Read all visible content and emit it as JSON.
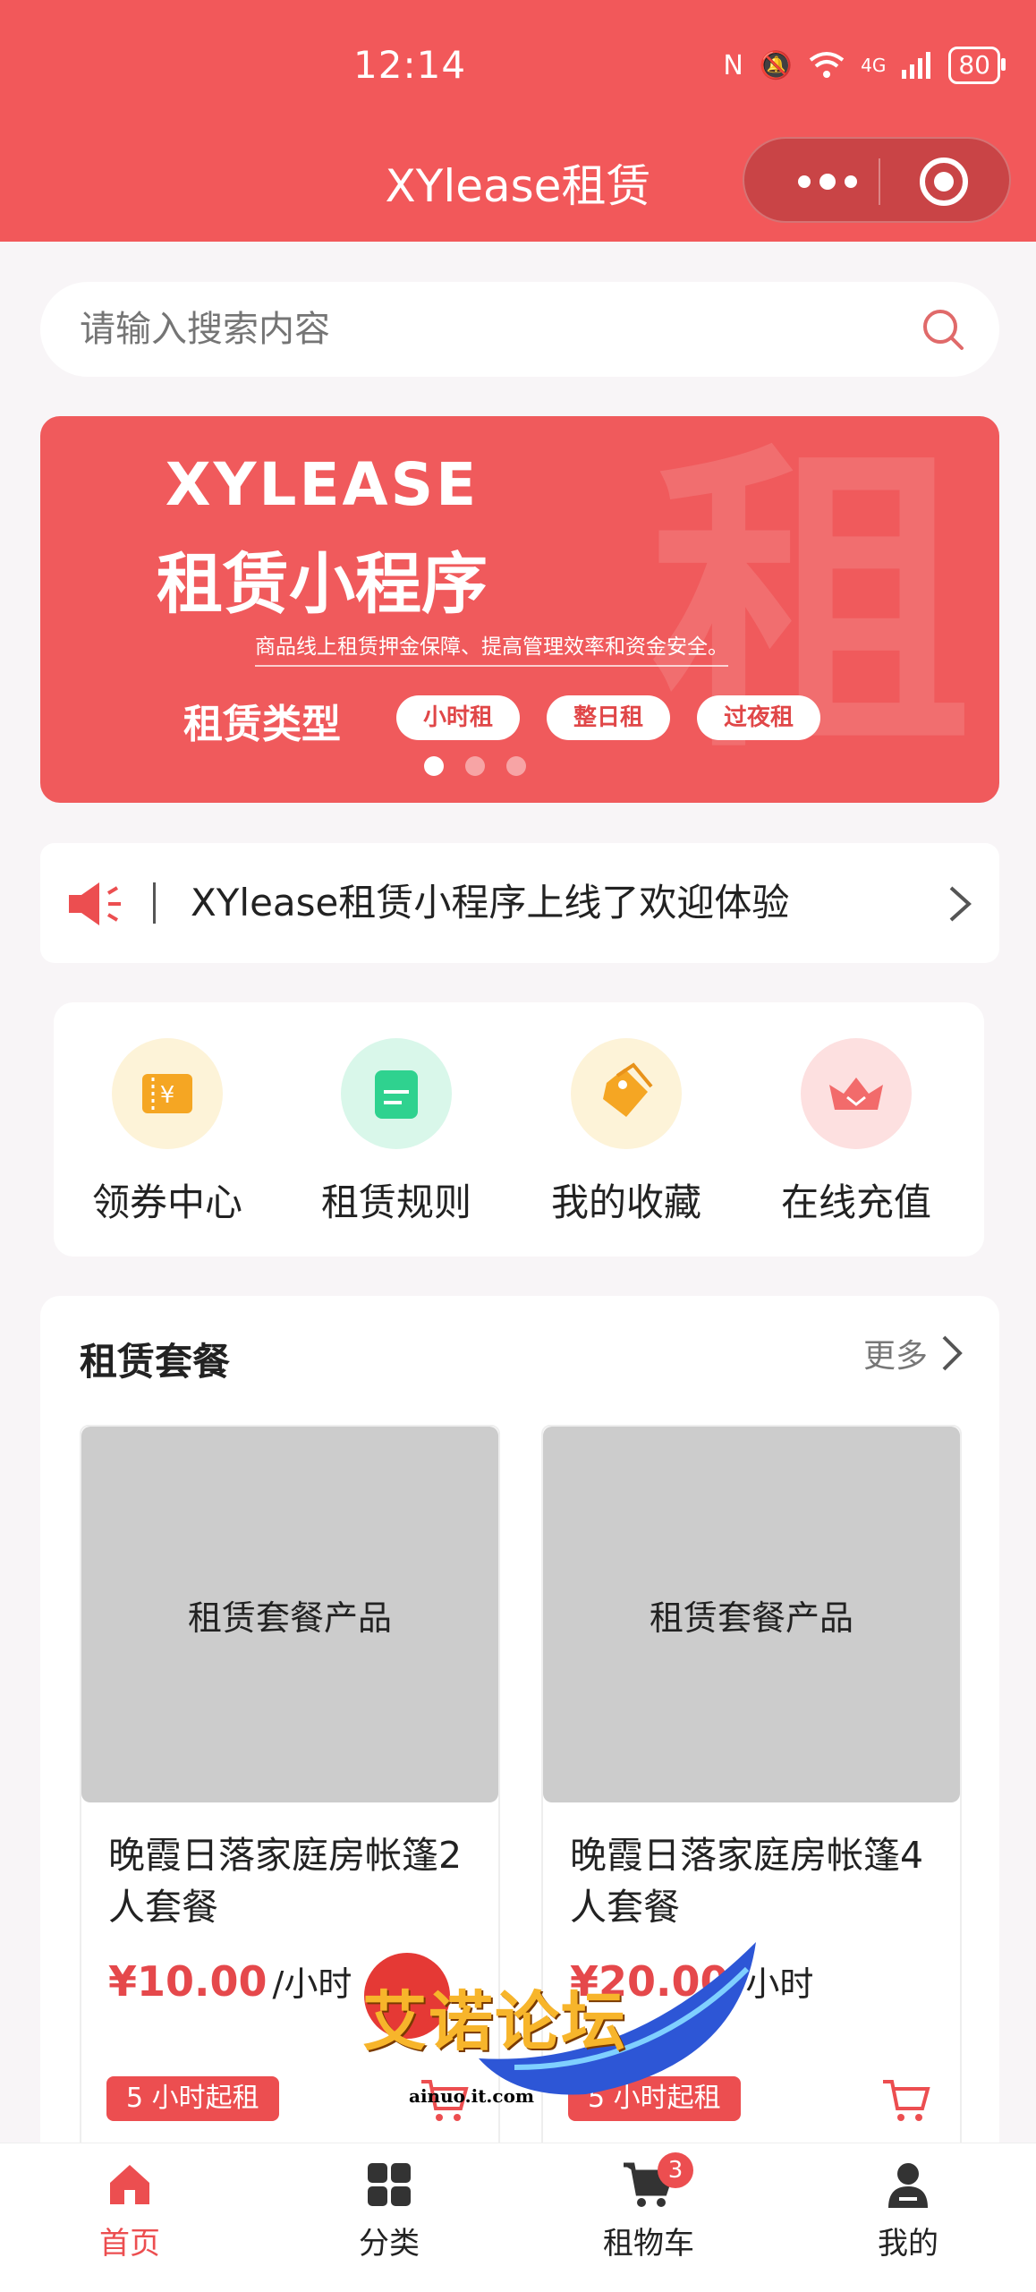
{
  "status_bar": {
    "time": "12:14",
    "battery": "80",
    "network": "4G"
  },
  "header": {
    "title": "XYlease租赁"
  },
  "search": {
    "placeholder": "请输入搜索内容"
  },
  "banner": {
    "brand": "XYLEASE",
    "title": "租赁小程序",
    "description": "商品线上租赁押金保障、提高管理效率和资金安全。",
    "type_label": "租赁类型",
    "chips": [
      "小时租",
      "整日租",
      "过夜租"
    ],
    "bg_glyph": "租"
  },
  "notice": {
    "text": "XYlease租赁小程序上线了欢迎体验"
  },
  "quick_nav": [
    {
      "label": "领券中心",
      "icon": "coupon-icon",
      "color": "#f5a623"
    },
    {
      "label": "租赁规则",
      "icon": "rules-icon",
      "color": "#2fd28f"
    },
    {
      "label": "我的收藏",
      "icon": "favorite-tag-icon",
      "color": "#f5a623"
    },
    {
      "label": "在线充值",
      "icon": "recharge-icon",
      "color": "#f26b6b"
    }
  ],
  "packages": {
    "title": "租赁套餐",
    "more": "更多",
    "items": [
      {
        "image_text": "租赁套餐产品",
        "name": "晚霞日落家庭房帐篷2人套餐",
        "price": "¥10.00",
        "unit": "/小时",
        "tag": "5 小时起租"
      },
      {
        "image_text": "租赁套餐产品",
        "name": "晚霞日落家庭房帐篷4人套餐",
        "price": "¥20.00",
        "unit": "/小时",
        "tag": "5 小时起租"
      }
    ]
  },
  "watermark": {
    "text": "艾诺论坛",
    "url": "ainuo.it.com"
  },
  "tabbar": {
    "items": [
      {
        "label": "首页",
        "icon": "home-icon"
      },
      {
        "label": "分类",
        "icon": "category-icon"
      },
      {
        "label": "租物车",
        "icon": "cart-icon",
        "badge": "3"
      },
      {
        "label": "我的",
        "icon": "profile-icon"
      }
    ]
  },
  "colors": {
    "brand": "#f2585a",
    "accent": "#ec4e50",
    "price": "#e5484b"
  }
}
